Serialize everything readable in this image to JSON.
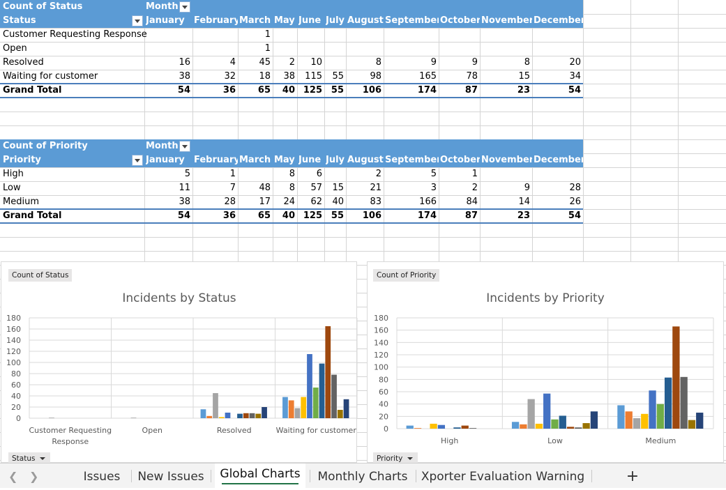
{
  "months": [
    "January",
    "February",
    "March",
    "May",
    "June",
    "July",
    "August",
    "September",
    "October",
    "November",
    "December"
  ],
  "status_table": {
    "header1": "Count of Status",
    "header_col": "Month",
    "header2": "Status",
    "rows": [
      {
        "label": "Customer Requesting Response",
        "values": [
          "",
          "",
          "1",
          "",
          "",
          "",
          "",
          "",
          "",
          "",
          ""
        ]
      },
      {
        "label": "Open",
        "values": [
          "",
          "",
          "1",
          "",
          "",
          "",
          "",
          "",
          "",
          "",
          ""
        ]
      },
      {
        "label": "Resolved",
        "values": [
          "16",
          "4",
          "45",
          "2",
          "10",
          "",
          "8",
          "9",
          "9",
          "8",
          "20"
        ]
      },
      {
        "label": "Waiting for customer",
        "values": [
          "38",
          "32",
          "18",
          "38",
          "115",
          "55",
          "98",
          "165",
          "78",
          "15",
          "34"
        ]
      }
    ],
    "total": {
      "label": "Grand Total",
      "values": [
        "54",
        "36",
        "65",
        "40",
        "125",
        "55",
        "106",
        "174",
        "87",
        "23",
        "54"
      ]
    }
  },
  "priority_table": {
    "header1": "Count of Priority",
    "header_col": "Month",
    "header2": "Priority",
    "rows": [
      {
        "label": "High",
        "values": [
          "5",
          "1",
          "",
          "8",
          "6",
          "",
          "2",
          "5",
          "1",
          "",
          ""
        ]
      },
      {
        "label": "Low",
        "values": [
          "11",
          "7",
          "48",
          "8",
          "57",
          "15",
          "21",
          "3",
          "2",
          "9",
          "28"
        ]
      },
      {
        "label": "Medium",
        "values": [
          "38",
          "28",
          "17",
          "24",
          "62",
          "40",
          "83",
          "166",
          "84",
          "14",
          "26"
        ]
      }
    ],
    "total": {
      "label": "Grand Total",
      "values": [
        "54",
        "36",
        "65",
        "40",
        "125",
        "55",
        "106",
        "174",
        "87",
        "23",
        "54"
      ]
    }
  },
  "series_colors": [
    "#5b9bd5",
    "#ed7d31",
    "#a5a5a5",
    "#ffc000",
    "#4472c4",
    "#70ad47",
    "#255e91",
    "#9e480e",
    "#636363",
    "#997300",
    "#264478"
  ],
  "chart_data": [
    {
      "type": "bar",
      "title": "Incidents by Status",
      "field_button": "Count of Status",
      "axis_button": "Status",
      "categories": [
        "Customer Requesting Response",
        "Open",
        "Resolved",
        "Waiting for customer"
      ],
      "ylim": [
        0,
        180
      ],
      "yticks": [
        0,
        20,
        40,
        60,
        80,
        100,
        120,
        140,
        160,
        180
      ],
      "grid": true,
      "series": [
        {
          "name": "January",
          "values": [
            0,
            0,
            16,
            38
          ]
        },
        {
          "name": "February",
          "values": [
            0,
            0,
            4,
            32
          ]
        },
        {
          "name": "March",
          "values": [
            1,
            1,
            45,
            18
          ]
        },
        {
          "name": "May",
          "values": [
            0,
            0,
            2,
            38
          ]
        },
        {
          "name": "June",
          "values": [
            0,
            0,
            10,
            115
          ]
        },
        {
          "name": "July",
          "values": [
            0,
            0,
            0,
            55
          ]
        },
        {
          "name": "August",
          "values": [
            0,
            0,
            8,
            98
          ]
        },
        {
          "name": "September",
          "values": [
            0,
            0,
            9,
            165
          ]
        },
        {
          "name": "October",
          "values": [
            0,
            0,
            9,
            78
          ]
        },
        {
          "name": "November",
          "values": [
            0,
            0,
            8,
            15
          ]
        },
        {
          "name": "December",
          "values": [
            0,
            0,
            20,
            34
          ]
        }
      ]
    },
    {
      "type": "bar",
      "title": "Incidents by Priority",
      "field_button": "Count of Priority",
      "axis_button": "Priority",
      "categories": [
        "High",
        "Low",
        "Medium"
      ],
      "ylim": [
        0,
        180
      ],
      "yticks": [
        0,
        20,
        40,
        60,
        80,
        100,
        120,
        140,
        160,
        180
      ],
      "grid": true,
      "series": [
        {
          "name": "January",
          "values": [
            5,
            11,
            38
          ]
        },
        {
          "name": "February",
          "values": [
            1,
            7,
            28
          ]
        },
        {
          "name": "March",
          "values": [
            0,
            48,
            17
          ]
        },
        {
          "name": "May",
          "values": [
            8,
            8,
            24
          ]
        },
        {
          "name": "June",
          "values": [
            6,
            57,
            62
          ]
        },
        {
          "name": "July",
          "values": [
            0,
            15,
            40
          ]
        },
        {
          "name": "August",
          "values": [
            2,
            21,
            83
          ]
        },
        {
          "name": "September",
          "values": [
            5,
            3,
            166
          ]
        },
        {
          "name": "October",
          "values": [
            1,
            2,
            84
          ]
        },
        {
          "name": "November",
          "values": [
            0,
            9,
            14
          ]
        },
        {
          "name": "December",
          "values": [
            0,
            28,
            26
          ]
        }
      ]
    }
  ],
  "tabs": {
    "prev_icon": "chevron-left-icon",
    "next_icon": "chevron-right-icon",
    "items": [
      "Issues",
      "New Issues",
      "Global Charts",
      "Monthly Charts",
      "Xporter Evaluation Warning"
    ],
    "active": "Global Charts",
    "add_label": "+"
  }
}
